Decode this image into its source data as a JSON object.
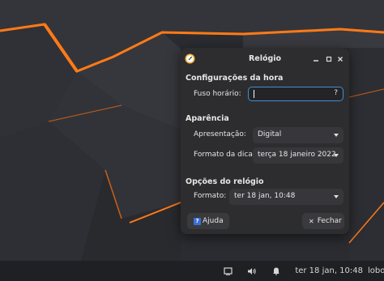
{
  "dialog": {
    "title": "Relógio",
    "sections": {
      "time": "Configurações da hora",
      "appearance": "Aparência",
      "clock": "Opções do relógio"
    },
    "timezone": {
      "label": "Fuso horário:",
      "value": "",
      "help_glyph": "?"
    },
    "presentation": {
      "label": "Apresentação:",
      "value": "Digital"
    },
    "tooltip_format": {
      "label": "Formato da dica:",
      "value": "terça 18 janeiro 2022"
    },
    "format": {
      "label": "Formato:",
      "value": "ter 18 jan, 10:48"
    },
    "help_button": "Ajuda",
    "help_icon_glyph": "?",
    "close_button": "Fechar",
    "close_glyph": "✕"
  },
  "panel": {
    "clock": "ter 18 jan, 10:48",
    "user": "lobo"
  },
  "icons": [
    "clock-app-icon",
    "minimize-icon",
    "maximize-icon",
    "close-icon",
    "help-icon",
    "display-icon",
    "volume-icon",
    "notification-bell-icon"
  ],
  "colors": {
    "accent": "#3d8fd6",
    "wallpaper_edge": "#ff7a18",
    "wallpaper_base": "#2b2c31"
  }
}
